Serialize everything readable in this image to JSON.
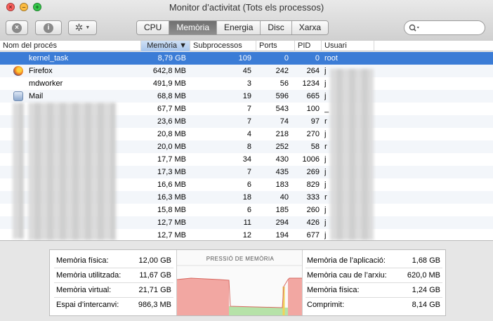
{
  "window": {
    "title": "Monitor d’activitat (Tots els processos)"
  },
  "toolbar": {
    "close_process_icon": "x-circle-icon",
    "inspect_icon": "info-circle-icon",
    "action_icon": "gear-icon",
    "tabs": [
      "CPU",
      "Memòria",
      "Energia",
      "Disc",
      "Xarxa"
    ],
    "active_tab": "Memòria",
    "search": {
      "value": "",
      "placeholder": ""
    }
  },
  "table": {
    "columns": [
      "Nom del procés",
      "Memòria ▼",
      "Subprocessos",
      "Ports",
      "PID",
      "Usuari"
    ],
    "sorted_column": "Memòria",
    "rows": [
      {
        "name": "kernel_task",
        "memory": "8,79 GB",
        "threads": "109",
        "ports": "0",
        "pid": "0",
        "user": "root",
        "selected": true
      },
      {
        "name": "Firefox",
        "memory": "642,8 MB",
        "threads": "45",
        "ports": "242",
        "pid": "264",
        "user": "j"
      },
      {
        "name": "mdworker",
        "memory": "491,9 MB",
        "threads": "3",
        "ports": "56",
        "pid": "1234",
        "user": "j"
      },
      {
        "name": "Mail",
        "memory": "68,8 MB",
        "threads": "19",
        "ports": "596",
        "pid": "665",
        "user": "j"
      },
      {
        "name": "",
        "memory": "67,7 MB",
        "threads": "7",
        "ports": "543",
        "pid": "100",
        "user": "_"
      },
      {
        "name": "",
        "memory": "23,6 MB",
        "threads": "7",
        "ports": "74",
        "pid": "97",
        "user": "r"
      },
      {
        "name": "",
        "memory": "20,8 MB",
        "threads": "4",
        "ports": "218",
        "pid": "270",
        "user": "j"
      },
      {
        "name": "",
        "memory": "20,0 MB",
        "threads": "8",
        "ports": "252",
        "pid": "58",
        "user": "r"
      },
      {
        "name": "",
        "memory": "17,7 MB",
        "threads": "34",
        "ports": "430",
        "pid": "1006",
        "user": "j"
      },
      {
        "name": "",
        "memory": "17,3 MB",
        "threads": "7",
        "ports": "435",
        "pid": "269",
        "user": "j"
      },
      {
        "name": "",
        "memory": "16,6 MB",
        "threads": "6",
        "ports": "183",
        "pid": "829",
        "user": "j"
      },
      {
        "name": "",
        "memory": "16,3 MB",
        "threads": "18",
        "ports": "40",
        "pid": "333",
        "user": "r"
      },
      {
        "name": "",
        "memory": "15,8 MB",
        "threads": "6",
        "ports": "185",
        "pid": "260",
        "user": "j"
      },
      {
        "name": "",
        "memory": "12,7 MB",
        "threads": "11",
        "ports": "294",
        "pid": "426",
        "user": "j"
      },
      {
        "name": "",
        "memory": "12,7 MB",
        "threads": "12",
        "ports": "194",
        "pid": "677",
        "user": "j"
      }
    ]
  },
  "memory_stats": {
    "left": [
      {
        "label": "Memòria física:",
        "value": "12,00 GB"
      },
      {
        "label": "Memòria utilitzada:",
        "value": "11,67 GB"
      },
      {
        "label": "Memòria virtual:",
        "value": "21,71 GB"
      },
      {
        "label": "Espai d’intercanvi:",
        "value": "986,3 MB"
      }
    ],
    "pressure_title": "PRESSIÓ DE MEMÒRIA",
    "right": [
      {
        "label": "Memòria de l’aplicació:",
        "value": "1,68 GB"
      },
      {
        "label": "Memòria cau de l’arxiu:",
        "value": "620,0 MB"
      },
      {
        "label": "Memòria física:",
        "value": "1,24 GB"
      },
      {
        "label": "Comprimit:",
        "value": "8,14 GB"
      }
    ]
  },
  "colors": {
    "selection": "#3b7cd6",
    "pressure_red": "#f2a7a2",
    "pressure_green": "#b6e2a8"
  }
}
